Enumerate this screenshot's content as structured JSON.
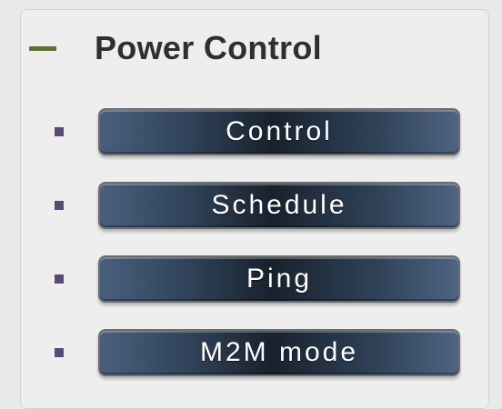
{
  "section": {
    "title": "Power Control",
    "collapse_icon": "minus-icon",
    "accent_color": "#5d7036",
    "bullet_color": "#5b4a75"
  },
  "menu": {
    "items": [
      {
        "label": "Control"
      },
      {
        "label": "Schedule"
      },
      {
        "label": "Ping"
      },
      {
        "label": "M2M mode"
      }
    ]
  }
}
